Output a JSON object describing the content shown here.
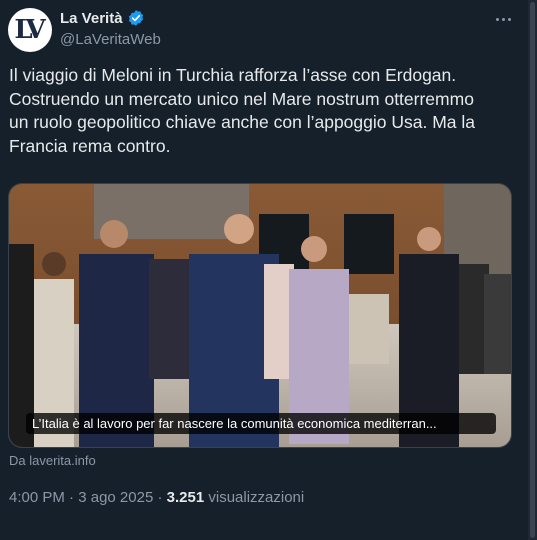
{
  "account": {
    "display_name": "La Verità",
    "handle": "@LaVeritaWeb",
    "avatar_logo": "LV"
  },
  "tweet": {
    "text": "Il viaggio di Meloni in Turchia rafforza l’asse con Erdogan.\nCostruendo un mercato unico nel Mare nostrum otterremmo\nun ruolo geopolitico chiave anche con l’appoggio Usa. Ma la\nFrancia rema contro.",
    "card_caption": "L’Italia è al lavoro per far nascere la comunità economica mediterran...",
    "card_source": "Da laverita.info",
    "time": "4:00 PM",
    "date": "3 ago 2025",
    "separator": "·",
    "views_count": "3.251",
    "views_label": "visualizzazioni"
  },
  "colors": {
    "background": "#15202b",
    "verified_badge": "#1d9bf0",
    "secondary_text": "#8b98a5"
  },
  "icons": [
    "verified-badge-icon",
    "more-options-icon"
  ]
}
